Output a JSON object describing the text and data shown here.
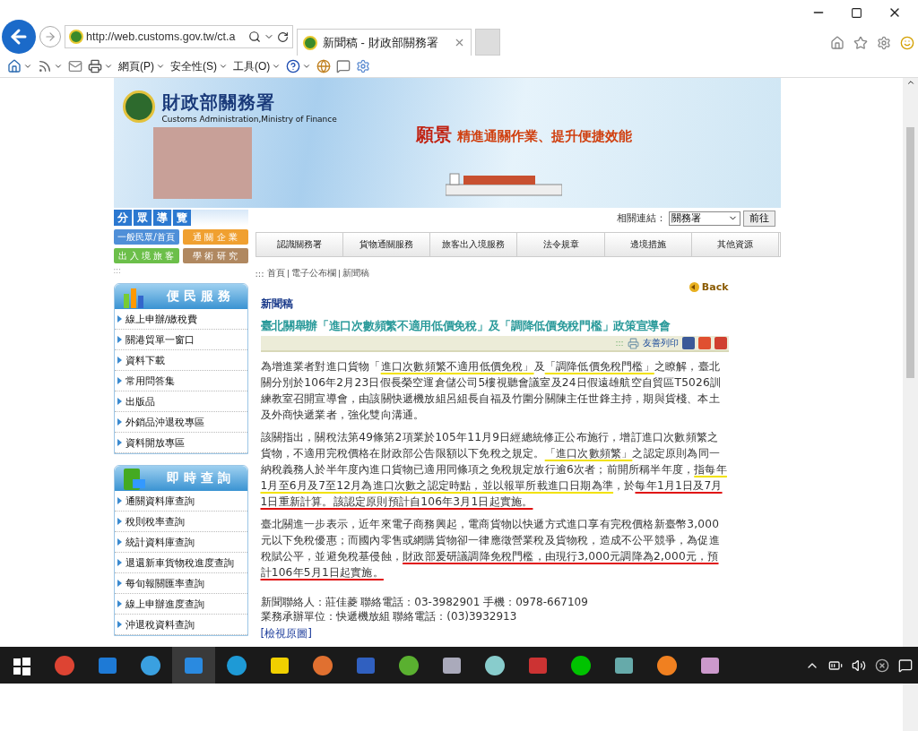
{
  "browser": {
    "url": "http://web.customs.gov.tw/ct.a",
    "tabs": [
      {
        "title": "新聞稿 - 財政部關務署",
        "selected": true
      }
    ],
    "toolbar": [
      {
        "label": "網頁(P)"
      },
      {
        "label": "安全性(S)"
      },
      {
        "label": "工具(O)"
      }
    ]
  },
  "banner": {
    "site_name": "財政部關務署",
    "site_name_en": "Customs Administration,Ministry of Finance",
    "vision_label": "願景",
    "slogan": "精進通關作業、提升便捷效能"
  },
  "audience": {
    "title": [
      "分",
      "眾",
      "導",
      "覽"
    ],
    "buttons": [
      {
        "label": "一般民眾/首頁",
        "color": "#4f8fd8"
      },
      {
        "label": "通 關 企 業",
        "color": "#f0a030"
      },
      {
        "label": "出 入 境 旅 客",
        "color": "#6cbf4a"
      },
      {
        "label": "學 術 研 究",
        "color": "#b08860"
      }
    ]
  },
  "related_links": {
    "label": "相關連結：",
    "value": "關務署",
    "button": "前往"
  },
  "nav": [
    "認識關務署",
    "貨物通關服務",
    "旅客出入境服務",
    "法令規章",
    "邊境措施",
    "其他資源"
  ],
  "breadcrumb": {
    "marker": ":::",
    "items": [
      "首頁",
      "電子公布欄",
      "新聞稿"
    ]
  },
  "sidebar": [
    {
      "title": "便民服務",
      "kind": "service",
      "items": [
        "線上申辦/繳稅費",
        "關港貿單一窗口",
        "資料下載",
        "常用問答集",
        "出版品",
        "外銷品沖退稅專區",
        "資料開放專區"
      ]
    },
    {
      "title": "即時查詢",
      "kind": "query",
      "items": [
        "通關資料庫查詢",
        "稅則稅率查詢",
        "統計資料庫查詢",
        "退還新車貨物稅進度查詢",
        "每旬報關匯率查詢",
        "線上申辦進度查詢",
        "沖退稅資料查詢"
      ]
    }
  ],
  "article": {
    "back": "Back",
    "section": "新聞稿",
    "title": "臺北關舉辦「進口次數頻繁不適用低價免稅」及「調降低價免稅門檻」政策宣導會",
    "tools_marker": ":::",
    "print": "友善列印",
    "paragraphs": [
      [
        {
          "text": "為增進業者對進口貨物「",
          "kind": "plain"
        },
        {
          "text": "進口次數頻繁不適用低價免稅」",
          "kind": "highlight"
        },
        {
          "text": "及",
          "kind": "plain"
        },
        {
          "text": "「調降低價免稅門檻」",
          "kind": "highlight"
        },
        {
          "text": "之瞭解，臺北關分別於106年2月23日假長榮空運倉儲公司5樓視聽會議室及24日假遠雄航空自貿區T5026訓練教室召開宣導會，由該關快遞機放組呂組長自福及竹圍分關陳主任世鋒主持，期與貨棧、本土及外商快遞業者，強化雙向溝通。",
          "kind": "plain"
        }
      ],
      [
        {
          "text": "該關指出，關稅法第49條第2項業於105年11月9日經總統修正公布施行，增訂進口次數頻繁之貨物，不適用完稅價格在財政部公告限額以下免稅之規定。",
          "kind": "plain"
        },
        {
          "text": "「進口次數頻繁」",
          "kind": "highlight"
        },
        {
          "text": "之認定原則為同一納稅義務人於半年度內進口貨物已適用同條項之免稅規定放行逾6次者；前開所稱半年度，",
          "kind": "plain"
        },
        {
          "text": "指每年1月至6月及7至12月為進口次數之認定時點，並以報單所載進口日期為準",
          "kind": "highlight"
        },
        {
          "text": "，於",
          "kind": "plain"
        },
        {
          "text": "每年1月1日及7月1日重新計算。該認定原則預計自106年3月1日起實施。",
          "kind": "emphasis"
        }
      ],
      [
        {
          "text": "臺北關進一步表示，近年來電子商務興起，電商貨物以快遞方式進口享有完稅價格新臺幣3,000元以下免稅優惠；而國內零售或網購貨物卻一律應徵營業稅及貨物稅，造成不公平競爭，為促進稅賦公平，並避免稅基侵蝕，",
          "kind": "plain"
        },
        {
          "text": "財政部爰研議調降免稅門檻，由現行3,000元調降為2,000元，預計106年5月1日起實施。",
          "kind": "emphasis"
        }
      ]
    ],
    "contacts": [
      "新聞聯絡人：莊佳菱 聯絡電話：03-3982901 手機：0978-667109",
      "業務承辦單位：快遞機放組 聯絡電話：(03)3932913"
    ],
    "view_original": "[檢視原圖]"
  }
}
